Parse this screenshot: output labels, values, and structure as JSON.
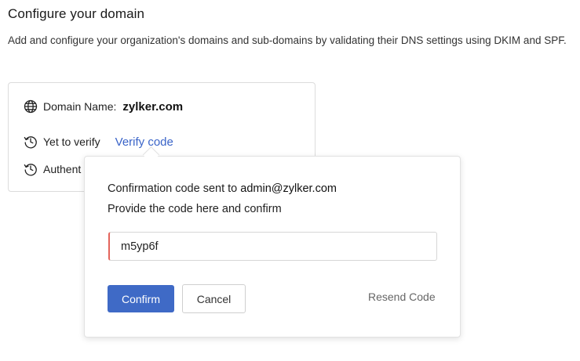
{
  "header": {
    "title": "Configure your domain",
    "description": "Add and configure your organization's domains and sub-domains by validating their DNS settings using DKIM and SPF."
  },
  "domain_card": {
    "domain_label": "Domain Name:",
    "domain_value": "zylker.com",
    "status_text": "Yet to verify",
    "verify_link": "Verify code",
    "auth_text": "Authent",
    "icons": {
      "domain": "globe-icon",
      "status": "history-clock-icon",
      "auth": "history-clock-icon"
    }
  },
  "popover": {
    "line1_prefix": "Confirmation code sent to ",
    "line1_email": "admin@zylker.com",
    "line2": "Provide the code here and confirm",
    "code_value": "m5yp6f",
    "confirm_label": "Confirm",
    "cancel_label": "Cancel",
    "resend_label": "Resend Code"
  },
  "colors": {
    "accent": "#3f6ac6",
    "link": "#3a64c8",
    "input_error_border": "#e4645c"
  }
}
